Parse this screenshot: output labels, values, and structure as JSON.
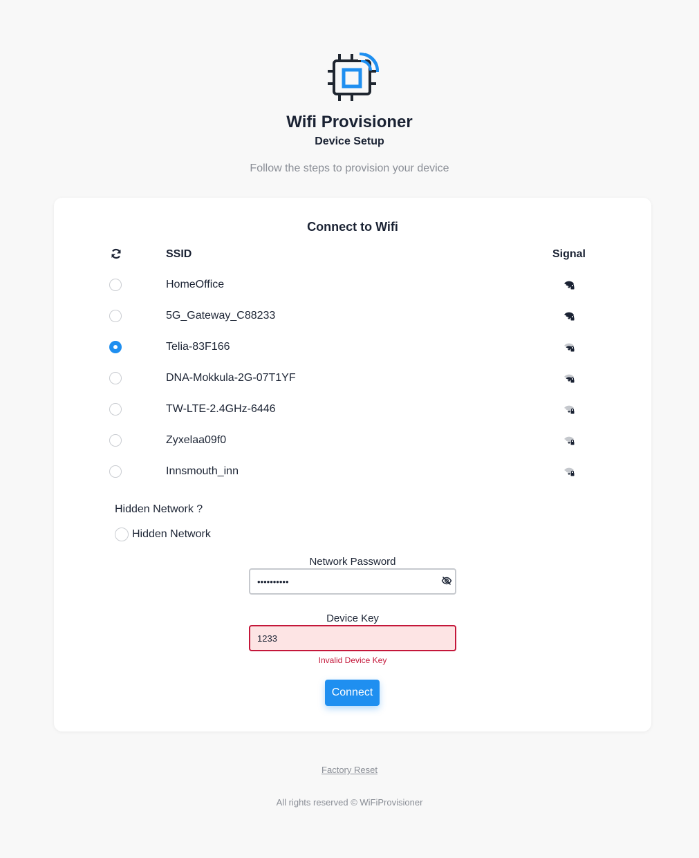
{
  "app": {
    "title": "Wifi Provisioner",
    "subtitle": "Device Setup",
    "description": "Follow the steps to provision your device",
    "logo_icon": "chip-wifi-icon"
  },
  "card": {
    "title": "Connect to Wifi",
    "refresh_icon": "refresh-icon",
    "col_ssid": "SSID",
    "col_signal": "Signal"
  },
  "networks": [
    {
      "ssid": "HomeOffice",
      "selected": false,
      "signal": 4
    },
    {
      "ssid": "5G_Gateway_C88233",
      "selected": false,
      "signal": 4
    },
    {
      "ssid": "Telia-83F166",
      "selected": true,
      "signal": 2
    },
    {
      "ssid": "DNA-Mokkula-2G-07T1YF",
      "selected": false,
      "signal": 2
    },
    {
      "ssid": "TW-LTE-2.4GHz-6446",
      "selected": false,
      "signal": 1
    },
    {
      "ssid": "Zyxelaa09f0",
      "selected": false,
      "signal": 1
    },
    {
      "ssid": "Innsmouth_inn",
      "selected": false,
      "signal": 1
    }
  ],
  "hidden": {
    "question": "Hidden Network ?",
    "label": "Hidden Network"
  },
  "password": {
    "label": "Network Password",
    "value": "••••••••••",
    "toggle_icon": "eye-off-icon"
  },
  "device_key": {
    "label": "Device Key",
    "value": "1233",
    "error": "Invalid Device Key"
  },
  "connect_label": "Connect",
  "factory_reset": "Factory Reset",
  "footer": "All rights reserved © WiFiProvisioner",
  "colors": {
    "accent": "#1f8ff0",
    "error": "#c4173a",
    "error_bg": "#fde4e4",
    "text": "#1c2434",
    "muted": "#8a8e96"
  }
}
